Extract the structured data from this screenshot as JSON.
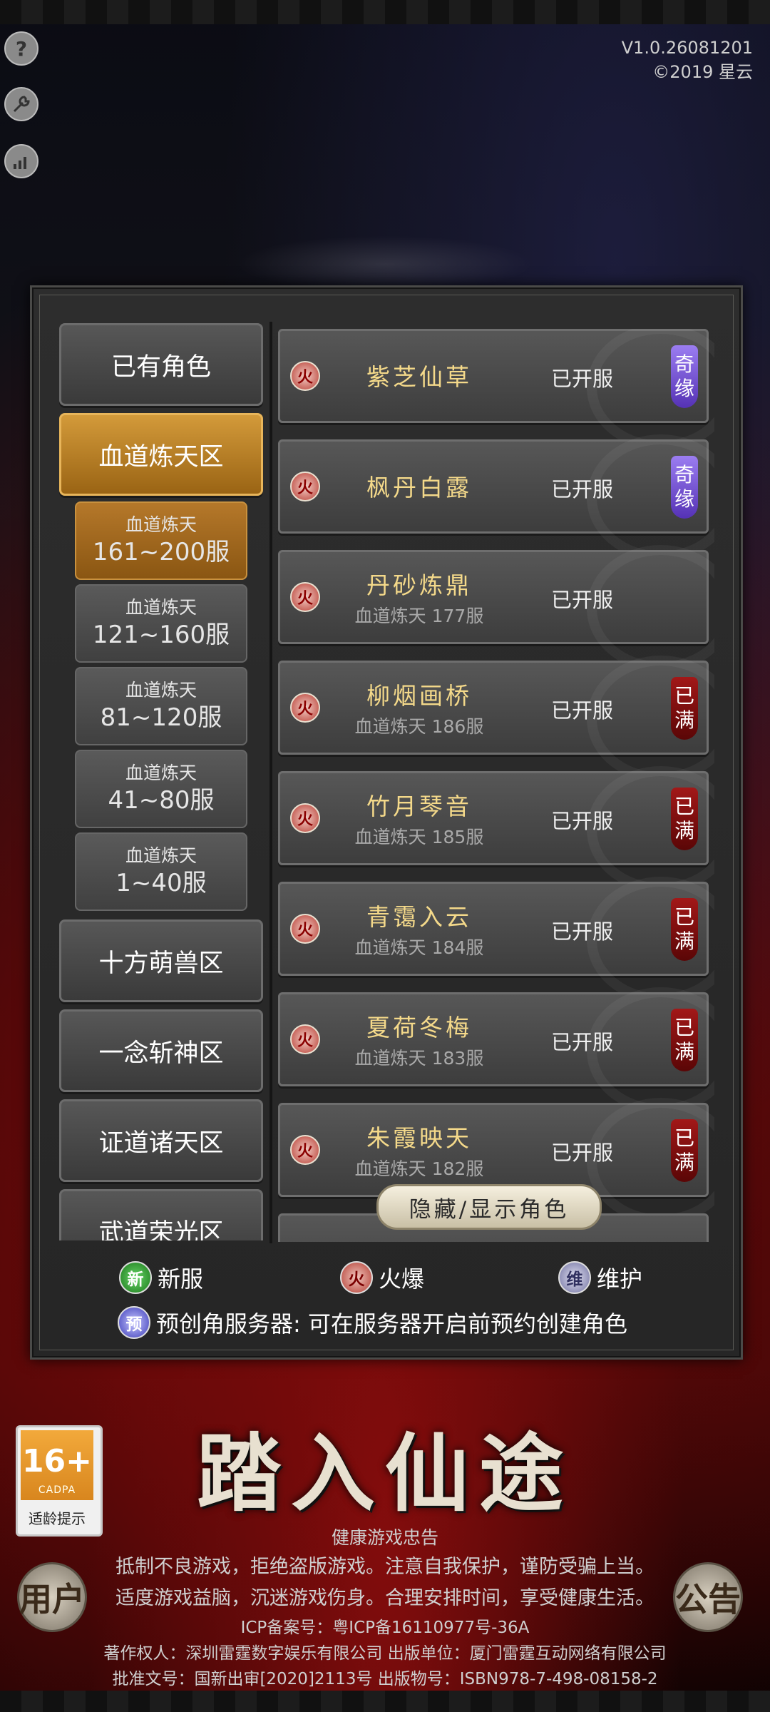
{
  "version": "V1.0.26081201",
  "copyright": "©2019 星云",
  "toolbar": {
    "help_glyph": "?"
  },
  "zones": [
    {
      "label": "已有角色"
    },
    {
      "label": "血道炼天区"
    },
    {
      "label": "十方萌兽区"
    },
    {
      "label": "一念斩神区"
    },
    {
      "label": "证道诸天区"
    },
    {
      "label": "武道荣光区"
    }
  ],
  "subzones": [
    {
      "line1": "血道炼天",
      "line2": "161~200服"
    },
    {
      "line1": "血道炼天",
      "line2": "121~160服"
    },
    {
      "line1": "血道炼天",
      "line2": "81~120服"
    },
    {
      "line1": "血道炼天",
      "line2": "41~80服"
    },
    {
      "line1": "血道炼天",
      "line2": "1~40服"
    }
  ],
  "servers": [
    {
      "name": "紫芝仙草",
      "sub": "",
      "status": "已开服",
      "tag": [
        "奇",
        "缘"
      ],
      "tag_type": "qiyuan"
    },
    {
      "name": "枫丹白露",
      "sub": "",
      "status": "已开服",
      "tag": [
        "奇",
        "缘"
      ],
      "tag_type": "qiyuan"
    },
    {
      "name": "丹砂炼鼎",
      "sub": "血道炼天 177服",
      "status": "已开服",
      "tag": [],
      "tag_type": ""
    },
    {
      "name": "柳烟画桥",
      "sub": "血道炼天 186服",
      "status": "已开服",
      "tag": [
        "已",
        "满"
      ],
      "tag_type": "full"
    },
    {
      "name": "竹月琴音",
      "sub": "血道炼天 185服",
      "status": "已开服",
      "tag": [
        "已",
        "满"
      ],
      "tag_type": "full"
    },
    {
      "name": "青霭入云",
      "sub": "血道炼天 184服",
      "status": "已开服",
      "tag": [
        "已",
        "满"
      ],
      "tag_type": "full"
    },
    {
      "name": "夏荷冬梅",
      "sub": "血道炼天 183服",
      "status": "已开服",
      "tag": [
        "已",
        "满"
      ],
      "tag_type": "full"
    },
    {
      "name": "朱霞映天",
      "sub": "血道炼天 182服",
      "status": "已开服",
      "tag": [
        "已",
        "满"
      ],
      "tag_type": "full"
    }
  ],
  "fire_glyph": "火",
  "toggle_label": "隐藏/显示角色",
  "legend": {
    "new_icon": "新",
    "new_label": "新服",
    "fire_icon": "火",
    "fire_label": "火爆",
    "maint_icon": "维",
    "maint_label": "维护",
    "pre_icon": "预",
    "pre_label": "预创角服务器: 可在服务器开启前预约创建角色"
  },
  "enter_label": "踏入仙途",
  "age": {
    "rating": "16+",
    "org": "CADPA",
    "label": "适龄提示"
  },
  "notice": {
    "title": "健康游戏忠告",
    "line1": "抵制不良游戏，拒绝盗版游戏。注意自我保护，谨防受骗上当。",
    "line2": "适度游戏益脑，沉迷游戏伤身。合理安排时间，享受健康生活。",
    "icp": "ICP备案号：粤ICP备16110977号-36A",
    "line3": "著作权人：深圳雷霆数字娱乐有限公司 出版单位：厦门雷霆互动网络有限公司",
    "line4": "批准文号：国新出审[2020]2113号 出版物号：ISBN978-7-498-08158-2"
  },
  "user_btn": "用户",
  "announce_btn": "公告"
}
